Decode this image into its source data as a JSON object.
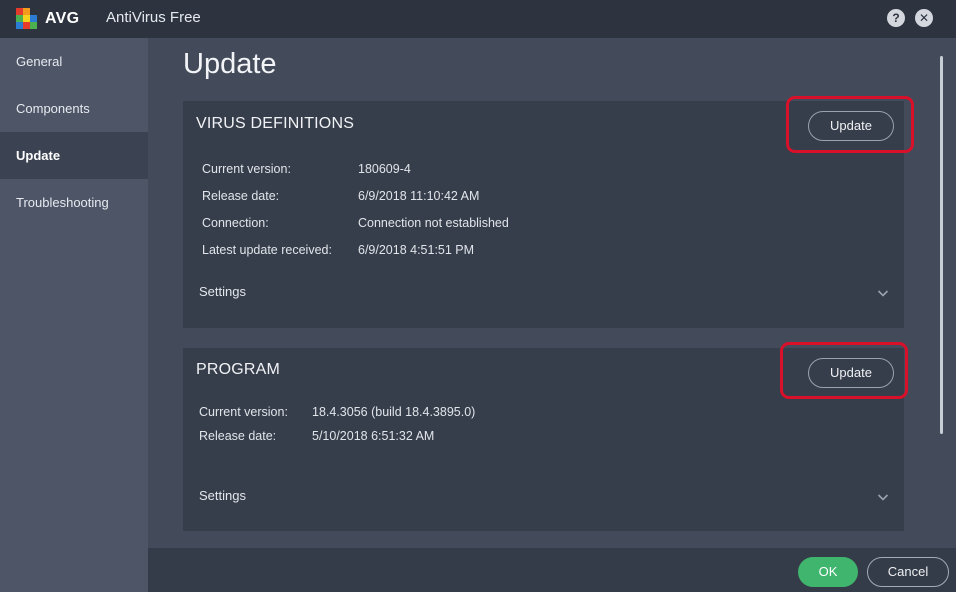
{
  "window": {
    "logo_text": "AVG",
    "title": "AntiVirus Free",
    "help_label": "?",
    "close_label": "✕"
  },
  "sidebar": {
    "items": [
      {
        "label": "General"
      },
      {
        "label": "Components"
      },
      {
        "label": "Update"
      },
      {
        "label": "Troubleshooting"
      }
    ],
    "active_index": 2
  },
  "main": {
    "title": "Update",
    "virus_definitions": {
      "heading": "VIRUS DEFINITIONS",
      "update_label": "Update",
      "rows": [
        {
          "label": "Current version:",
          "value": "180609-4"
        },
        {
          "label": "Release date:",
          "value": "6/9/2018 11:10:42 AM"
        },
        {
          "label": "Connection:",
          "value": "Connection not established"
        },
        {
          "label": "Latest update received:",
          "value": "6/9/2018 4:51:51 PM"
        }
      ],
      "settings_label": "Settings"
    },
    "program": {
      "heading": "PROGRAM",
      "update_label": "Update",
      "rows": [
        {
          "label": "Current version:",
          "value": "18.4.3056 (build 18.4.3895.0)"
        },
        {
          "label": "Release date:",
          "value": "5/10/2018 6:51:32 AM"
        }
      ],
      "settings_label": "Settings"
    }
  },
  "footer": {
    "ok_label": "OK",
    "cancel_label": "Cancel"
  },
  "colors": {
    "accent_green": "#3fb56d",
    "highlight_red": "#d8102a",
    "titlebar": "#2d333f",
    "sidebar": "#4d5567",
    "panel": "#373e4b"
  }
}
